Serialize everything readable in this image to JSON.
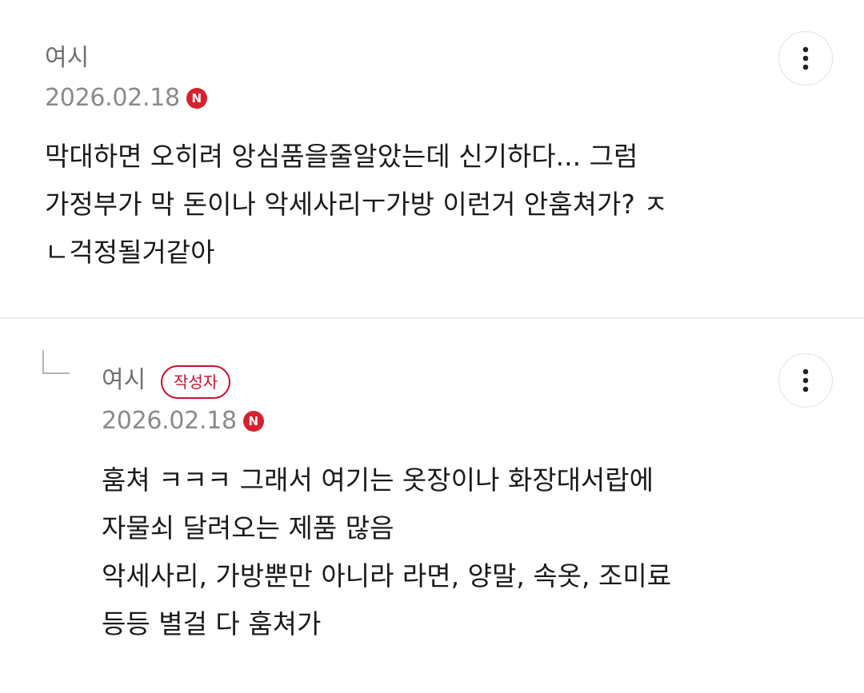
{
  "comments": [
    {
      "author": "여시",
      "date": "2026.02.18",
      "new_badge": "N",
      "body": "막대하면 오히려 앙심품을줄알았는데 신기하다... 그럼\n가정부가 막 돈이나 악세사리ㅜ가방 이런거 안훔쳐가? ㅈ\nㄴ걱정될거같아",
      "more_icon": "more-vertical-icon"
    },
    {
      "author": "여시",
      "author_badge": "작성자",
      "date": "2026.02.18",
      "new_badge": "N",
      "body": "훔쳐 ㅋㅋㅋ 그래서 여기는 옷장이나 화장대서랍에\n자물쇠 달려오는 제품 많음\n악세사리, 가방뿐만 아니라 라면, 양말, 속옷, 조미료\n등등 별걸 다 훔쳐가",
      "more_icon": "more-vertical-icon",
      "reply_icon": "reply-arrow-icon"
    }
  ],
  "colors": {
    "new_badge": "#d8202f",
    "author_badge": "#c8102e",
    "divider": "#ebebeb"
  }
}
